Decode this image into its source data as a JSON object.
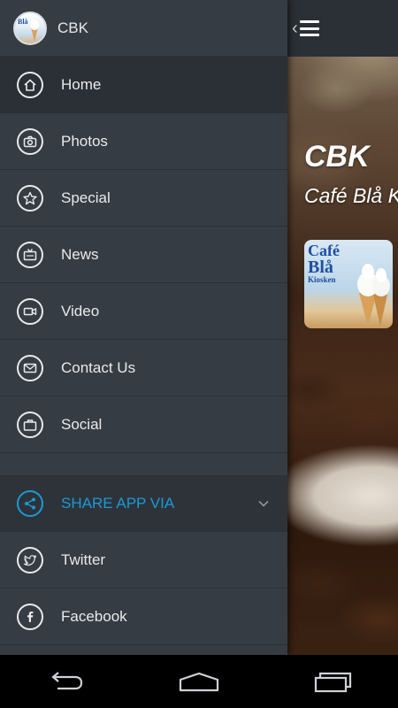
{
  "app": {
    "name": "CBK"
  },
  "hero": {
    "title": "CBK",
    "subtitle": "Café Blå K"
  },
  "menu": {
    "items": [
      {
        "label": "Home",
        "icon": "home-icon",
        "active": true
      },
      {
        "label": "Photos",
        "icon": "camera-icon",
        "active": false
      },
      {
        "label": "Special",
        "icon": "star-icon",
        "active": false
      },
      {
        "label": "News",
        "icon": "tv-icon",
        "active": false
      },
      {
        "label": "Video",
        "icon": "video-camera-icon",
        "active": false
      },
      {
        "label": "Contact Us",
        "icon": "envelope-icon",
        "active": false
      },
      {
        "label": "Social",
        "icon": "briefcase-icon",
        "active": false
      }
    ],
    "share": {
      "label": "SHARE APP VIA",
      "icon": "share-icon"
    },
    "share_items": [
      {
        "label": "Twitter",
        "icon": "twitter-icon"
      },
      {
        "label": "Facebook",
        "icon": "facebook-icon"
      }
    ]
  },
  "colors": {
    "drawer_bg": "#363c43",
    "active_bg": "#2b3036",
    "accent": "#1a9ad6",
    "text": "#e8eaec"
  },
  "navbar": {
    "buttons": [
      "back-icon",
      "home-icon",
      "recents-icon"
    ]
  }
}
